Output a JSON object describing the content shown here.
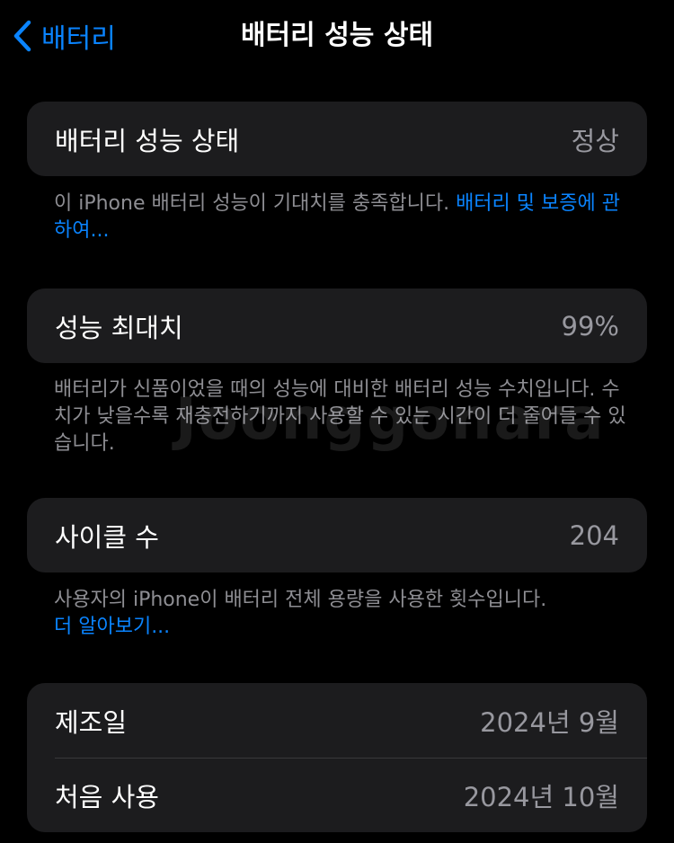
{
  "nav": {
    "back_label": "배터리",
    "back_icon": "chevron-left-icon",
    "title": "배터리 성능 상태"
  },
  "health": {
    "label": "배터리 성능 상태",
    "value": "정상",
    "footnote": "이 iPhone 배터리 성능이 기대치를 충족합니다. ",
    "link": "배터리 및 보증에 관하여..."
  },
  "capacity": {
    "label": "성능 최대치",
    "value": "99%",
    "footnote": "배터리가 신품이었을 때의 성능에 대비한 배터리 성능 수치입니다. 수치가 낮을수록 재충전하기까지 사용할 수 있는 시간이 더 줄어들 수 있습니다."
  },
  "cycles": {
    "label": "사이클 수",
    "value": "204",
    "footnote": "사용자의 iPhone이 배터리 전체 용량을 사용한 횟수입니다.",
    "link": "더 알아보기..."
  },
  "dates": {
    "manufactured_label": "제조일",
    "manufactured_value": "2024년 9월",
    "first_use_label": "처음 사용",
    "first_use_value": "2024년 10월"
  },
  "watermark": "Joonggonara",
  "colors": {
    "accent": "#0a84ff",
    "background": "#000000",
    "card": "#1c1c1e",
    "secondary_text": "#8e8e93"
  }
}
